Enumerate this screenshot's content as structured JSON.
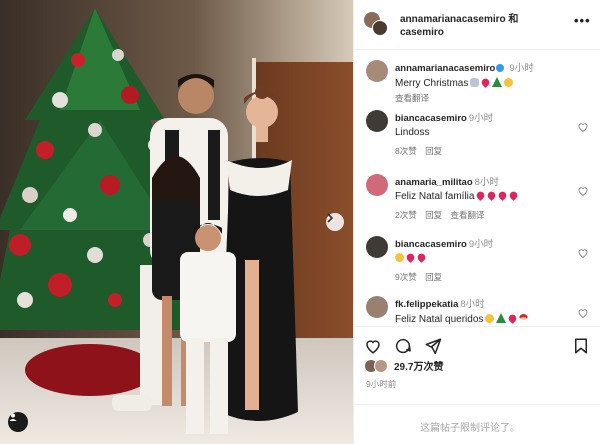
{
  "post": {
    "header_title": "annamarianacasemiro 和 casemiro",
    "more_label": "•••"
  },
  "caption": {
    "username": "annamarianacasemiro",
    "time": "9小时",
    "text": "Merry Christmas",
    "emojis": [
      "hands-icon",
      "heart-icon",
      "tree-icon",
      "face-icon"
    ],
    "translate_label": "查看翻译"
  },
  "comments": [
    {
      "username": "biancacasemiro",
      "time": "9小时",
      "text": "Lindoss",
      "replies_label": "8次赞",
      "reply_label": "回复",
      "translate_label": ""
    },
    {
      "username": "anamaria_militao",
      "time": "8小时",
      "text": "Feliz Natal família",
      "emojis": [
        "heart-icon",
        "heart-icon",
        "heart-icon",
        "heart-icon"
      ],
      "replies_label": "2次赞",
      "reply_label": "回复",
      "translate_label": "查看翻译"
    },
    {
      "username": "biancacasemiro",
      "time": "9小时",
      "text": "",
      "emojis": [
        "face-icon",
        "heart-icon",
        "heart-icon"
      ],
      "replies_label": "9次赞",
      "reply_label": "回复",
      "translate_label": ""
    },
    {
      "username": "fk.felippekatia",
      "time": "8小时",
      "text": "Feliz Natal queridos",
      "emojis": [
        "face-icon",
        "tree-icon",
        "heart-icon",
        "santa-icon"
      ],
      "replies_label": "",
      "reply_label": "",
      "translate_label": ""
    }
  ],
  "likes": {
    "count_label": "29.7万次赞"
  },
  "posted": {
    "time_label": "9小时前"
  },
  "footer": {
    "restricted_label": "这篇帖子限制评论了。"
  },
  "colors": {
    "verified": "#3897f0",
    "heart_red": "#e0245e",
    "text_primary": "#262626",
    "text_secondary": "#8e8e8e"
  }
}
